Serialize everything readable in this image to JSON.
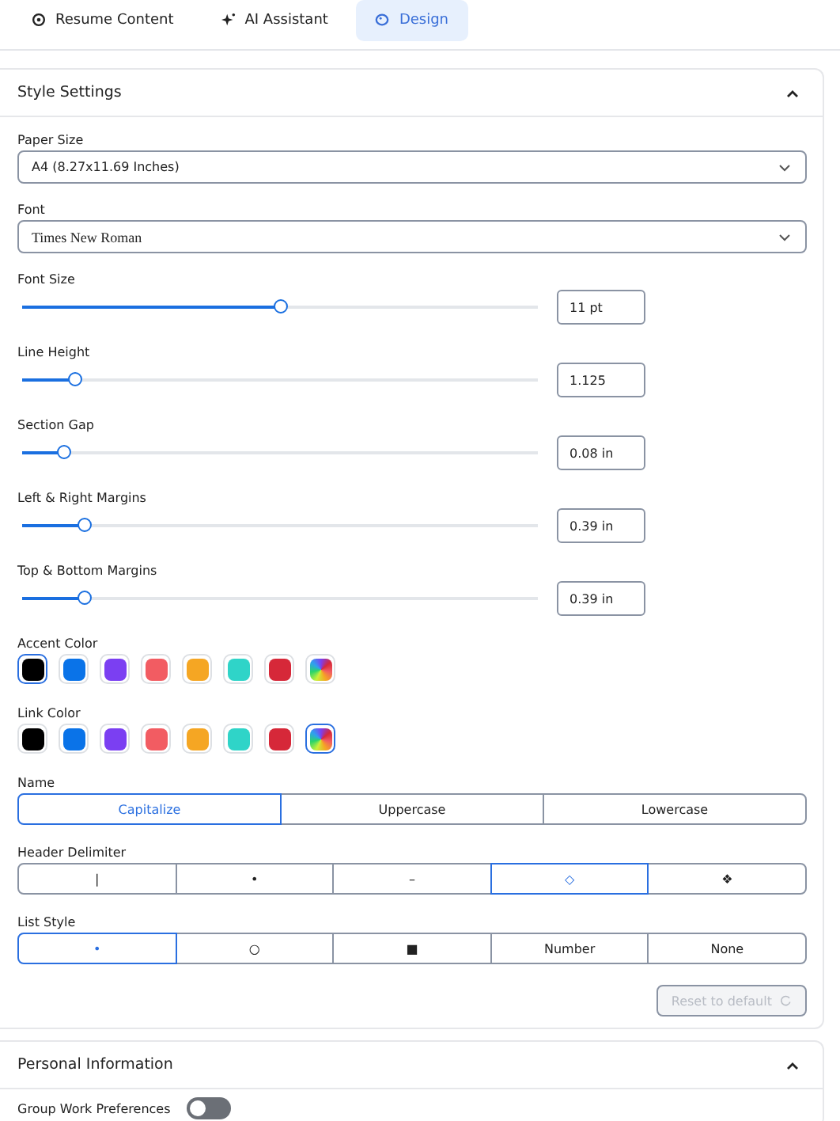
{
  "tabs": [
    {
      "label": "Resume Content",
      "selected": false
    },
    {
      "label": "AI Assistant",
      "selected": false
    },
    {
      "label": "Design",
      "selected": true
    }
  ],
  "style_settings": {
    "title": "Style Settings",
    "expanded": true,
    "selects": [
      {
        "label": "Paper Size",
        "value": "A4 (8.27x11.69 Inches)",
        "kind": "sans"
      },
      {
        "label": "Font",
        "value": "Times New Roman",
        "kind": "serif"
      }
    ],
    "sliders": [
      {
        "label": "Font Size",
        "level": 0.5,
        "value": "11 pt"
      },
      {
        "label": "Line Height",
        "level": 0.1,
        "value": "1.125"
      },
      {
        "label": "Section Gap",
        "level": 0.08,
        "value": "0.08 in"
      },
      {
        "label": "Left & Right Margins",
        "level": 0.12,
        "value": "0.39 in"
      },
      {
        "label": "Top & Bottom Margins",
        "level": 0.12,
        "value": "0.39 in"
      }
    ],
    "palettes": [
      {
        "label": "Accent Color",
        "swatches": [
          {
            "kind": "solid",
            "color": "#000000",
            "selected": true
          },
          {
            "kind": "solid",
            "color": "#0a73e8",
            "selected": false
          },
          {
            "kind": "solid",
            "color": "#7b3ff2",
            "selected": false
          },
          {
            "kind": "solid",
            "color": "#f25c62",
            "selected": false
          },
          {
            "kind": "solid",
            "color": "#f5a623",
            "selected": false
          },
          {
            "kind": "solid",
            "color": "#2fd4c8",
            "selected": false
          },
          {
            "kind": "solid",
            "color": "#d62839",
            "selected": false
          },
          {
            "kind": "gradient",
            "selected": false
          }
        ]
      },
      {
        "label": "Link Color",
        "swatches": [
          {
            "kind": "solid",
            "color": "#000000",
            "selected": false
          },
          {
            "kind": "solid",
            "color": "#0a73e8",
            "selected": false
          },
          {
            "kind": "solid",
            "color": "#7b3ff2",
            "selected": false
          },
          {
            "kind": "solid",
            "color": "#f25c62",
            "selected": false
          },
          {
            "kind": "solid",
            "color": "#f5a623",
            "selected": false
          },
          {
            "kind": "solid",
            "color": "#2fd4c8",
            "selected": false
          },
          {
            "kind": "solid",
            "color": "#d62839",
            "selected": false
          },
          {
            "kind": "gradient",
            "selected": true
          }
        ]
      }
    ],
    "segments": [
      {
        "label": "Name",
        "options": [
          {
            "label": "Capitalize",
            "selected": true
          },
          {
            "label": "Uppercase",
            "selected": false
          },
          {
            "label": "Lowercase",
            "selected": false
          }
        ]
      },
      {
        "label": "Header Delimiter",
        "options": [
          {
            "label": "|",
            "selected": false
          },
          {
            "label": "•",
            "selected": false
          },
          {
            "label": "–",
            "selected": false
          },
          {
            "label": "◇",
            "selected": true
          },
          {
            "label": "❖",
            "selected": false
          }
        ]
      },
      {
        "label": "List Style",
        "options": [
          {
            "label": "•",
            "selected": true
          },
          {
            "label": "○",
            "selected": false
          },
          {
            "label": "■",
            "selected": false
          },
          {
            "label": "Number",
            "selected": false
          },
          {
            "label": "None",
            "selected": false
          }
        ]
      }
    ],
    "reset_button": {
      "label": "Reset to default",
      "disabled": true
    }
  },
  "personal_information": {
    "title": "Personal Information",
    "expanded": true,
    "toggles": [
      {
        "label": "Group Work Preferences",
        "on": false
      }
    ]
  }
}
